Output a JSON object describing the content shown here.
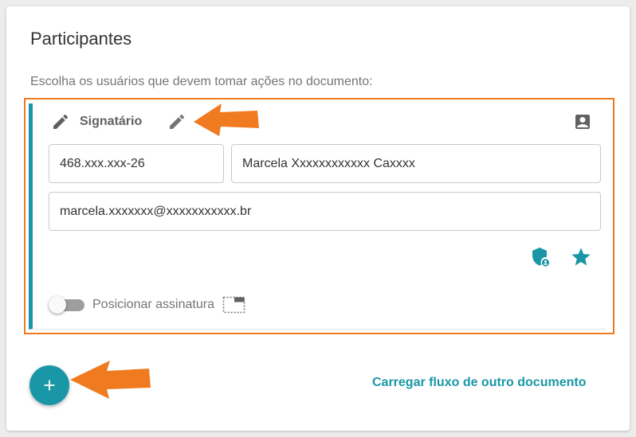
{
  "section": {
    "title": "Participantes",
    "subtitle": "Escolha os usuários que devem tomar ações no documento:"
  },
  "participant": {
    "role_label": "Signatário",
    "cpf": "468.xxx.xxx-26",
    "name": "Marcela Xxxxxxxxxxxx  Caxxxx",
    "email": "marcela.xxxxxxx@xxxxxxxxxxx.br",
    "position_toggle_label": "Posicionar assinatura",
    "position_toggle_on": false,
    "icons": {
      "role": "pen-icon",
      "edit_role": "pencil-icon",
      "contact": "contact-card-icon",
      "security": "shield-user-icon",
      "favorite": "star-icon",
      "position": "signature-position-icon"
    }
  },
  "actions": {
    "add_icon": "plus-icon",
    "load_flow_label": "Carregar fluxo de outro documento"
  },
  "annotations": {
    "highlight_color": "#f07a1f",
    "arrows": [
      "orange-arrow",
      "orange-arrow"
    ]
  },
  "colors": {
    "accent": "#1a97a6",
    "highlight": "#f07a1f",
    "text_primary": "#333333",
    "text_secondary": "#757575"
  }
}
